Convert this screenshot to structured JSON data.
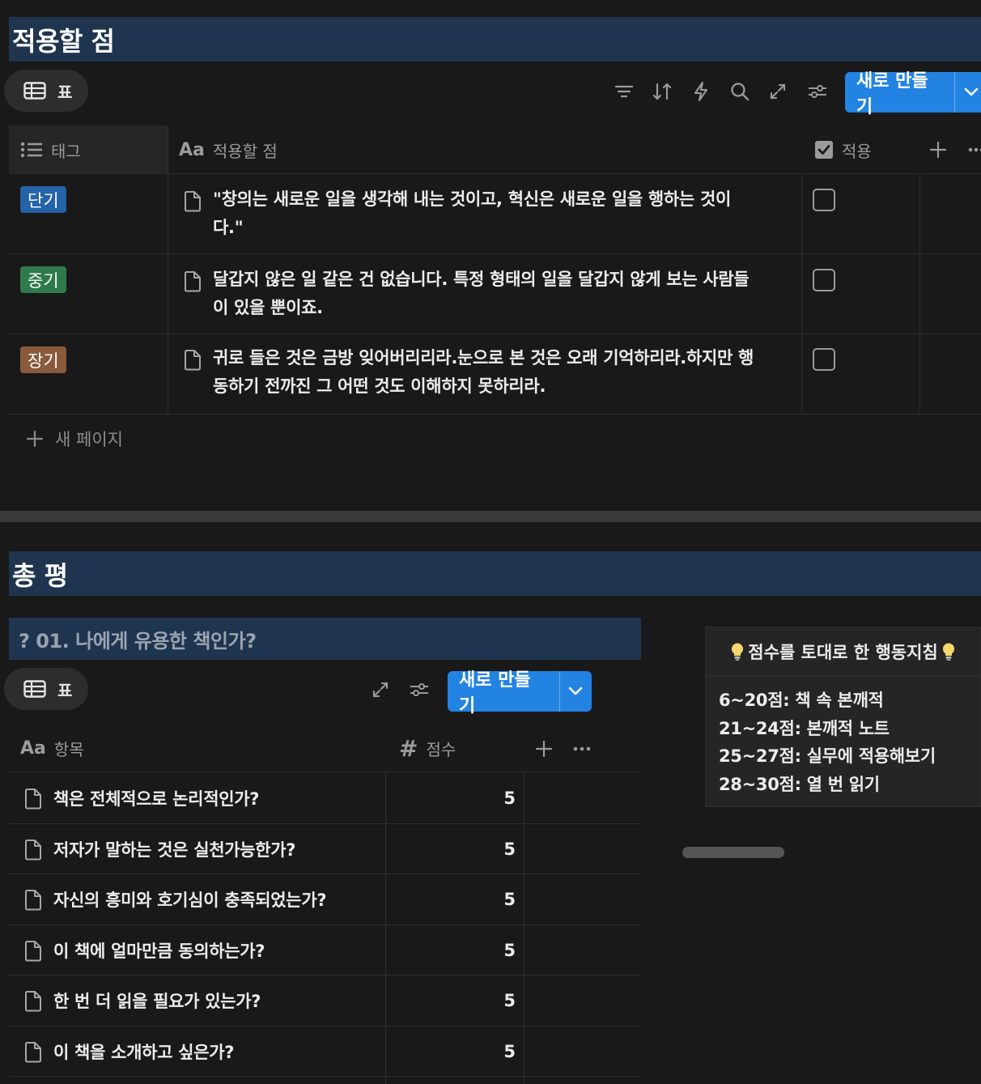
{
  "section1": {
    "title": "적용할 점",
    "view_label": "표",
    "new_button_label": "새로 만들기",
    "columns": {
      "tag": "태그",
      "point": "적용할 점",
      "applied": "적용"
    },
    "rows": [
      {
        "tag": "단기",
        "tag_color": "#2563a8",
        "text_line1": "\"창의는 새로운 일을 생각해 내는 것이고, 혁신은 새로운 일을 행하는 것이",
        "text_line2": "다.\"",
        "checked": false
      },
      {
        "tag": "중기",
        "tag_color": "#2e7a4a",
        "text_line1": "달갑지 않은 일 같은 건 없습니다. 특정 형태의 일을 달갑지 않게 보는 사람들",
        "text_line2": "이 있을 뿐이죠.",
        "checked": false
      },
      {
        "tag": "장기",
        "tag_color": "#8a5a3c",
        "text_line1": "귀로 들은 것은 금방 잊어버리리라.눈으로 본 것은 오래 기억하리라.하지만 행",
        "text_line2": "동하기 전까진 그 어떤 것도 이해하지 못하리라.",
        "checked": false
      }
    ],
    "new_page_label": "새 페이지"
  },
  "section2": {
    "title": "총 평",
    "sub_title": "? 01. 나에게 유용한 책인가?",
    "view_label": "표",
    "new_button_label": "새로 만들기",
    "columns": {
      "item": "항목",
      "score": "점수"
    },
    "rows": [
      {
        "item": "책은 전체적으로 논리적인가?",
        "score": "5"
      },
      {
        "item": "저자가 말하는 것은 실천가능한가?",
        "score": "5"
      },
      {
        "item": "자신의 흥미와 호기심이 충족되었는가?",
        "score": "5"
      },
      {
        "item": "이 책에 얼마만큼 동의하는가?",
        "score": "5"
      },
      {
        "item": "한 번 더 읽을 필요가 있는가?",
        "score": "5"
      },
      {
        "item": "이 책을 소개하고 싶은가?",
        "score": "5"
      }
    ],
    "callout": {
      "title": "점수를 토대로 한 행동지침",
      "lines": [
        "6~20점: 책 속 본깨적",
        "21~24점: 본깨적 노트",
        "25~27점: 실무에 적용해보기",
        "28~30점: 열 번 읽기"
      ]
    }
  },
  "colors": {
    "background": "#191919",
    "heading_bg": "#1f344f",
    "accent": "#2383e2"
  }
}
